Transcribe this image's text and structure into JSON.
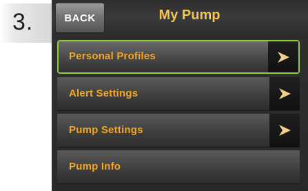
{
  "step": {
    "number": "3."
  },
  "header": {
    "back_label": "BACK",
    "title": "My Pump"
  },
  "menu": {
    "items": [
      {
        "label": "Personal Profiles",
        "selected": true,
        "has_arrow": true
      },
      {
        "label": "Alert Settings",
        "selected": false,
        "has_arrow": true
      },
      {
        "label": "Pump Settings",
        "selected": false,
        "has_arrow": true
      },
      {
        "label": "Pump Info",
        "selected": false,
        "has_arrow": false
      }
    ]
  },
  "colors": {
    "label": "#f5a623",
    "title": "#f5c451",
    "selection_border": "#8bd03a",
    "arrow": "#f3d08a"
  },
  "icons": {
    "arrow": "chevron-right-icon"
  }
}
